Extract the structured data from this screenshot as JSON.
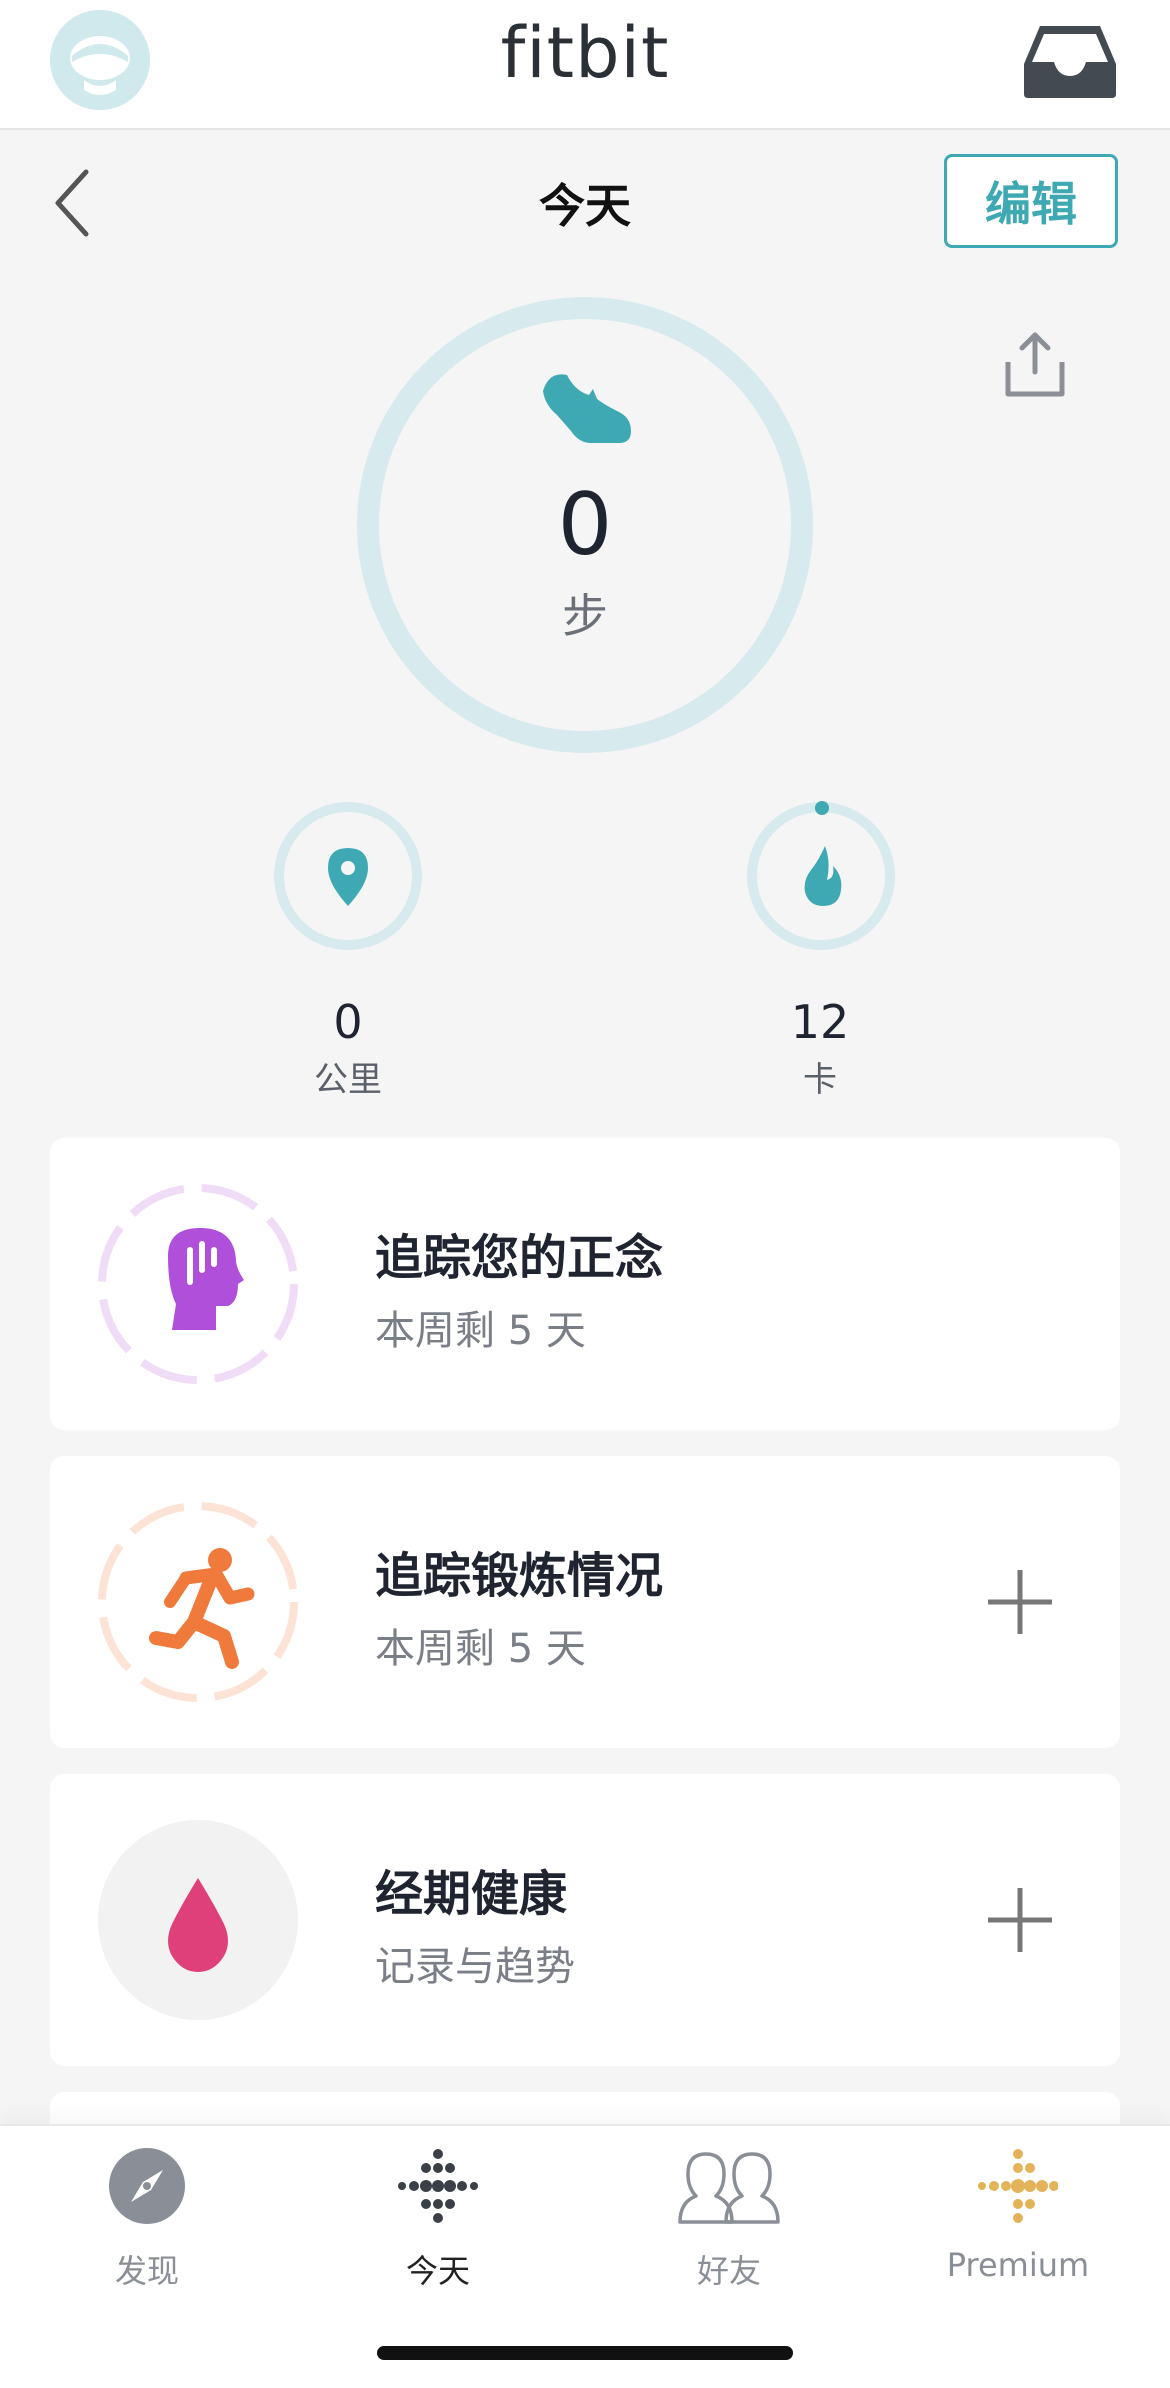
{
  "app": {
    "brand": "fitbit"
  },
  "header": {
    "title": "今天",
    "edit_label": "编辑"
  },
  "steps": {
    "value": "0",
    "unit": "步"
  },
  "stats": [
    {
      "value": "0",
      "unit": "公里",
      "icon": "location-pin-icon"
    },
    {
      "value": "12",
      "unit": "卡",
      "icon": "flame-icon"
    }
  ],
  "cards": [
    {
      "title": "追踪您的正念",
      "subtitle": "本周剩 5 天",
      "icon": "mindfulness-head-icon",
      "color": "#b04fd9"
    },
    {
      "title": "追踪锻炼情况",
      "subtitle": "本周剩 5 天",
      "icon": "running-icon",
      "color": "#f07a3c"
    },
    {
      "title": "经期健康",
      "subtitle": "记录与趋势",
      "icon": "drop-icon",
      "color": "#e0407a"
    }
  ],
  "tabs": [
    {
      "label": "发现",
      "icon": "compass-icon"
    },
    {
      "label": "今天",
      "icon": "fitbit-dots-icon",
      "active": true
    },
    {
      "label": "好友",
      "icon": "friends-icon"
    },
    {
      "label": "Premium",
      "icon": "premium-dots-icon"
    }
  ],
  "colors": {
    "accent": "#3fa9b3",
    "ring": "#d7eaed",
    "text": "#1f2430"
  }
}
